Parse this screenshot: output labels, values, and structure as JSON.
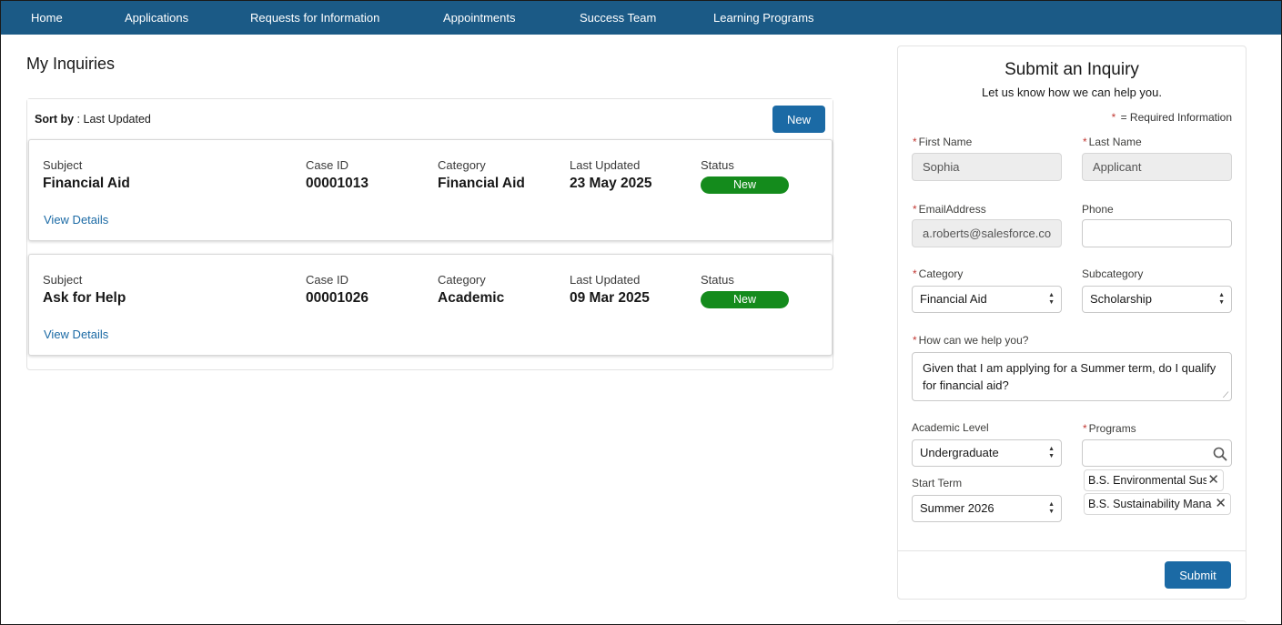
{
  "nav": {
    "items": [
      "Home",
      "Applications",
      "Requests for Information",
      "Appointments",
      "Success Team",
      "Learning Programs"
    ]
  },
  "inquiries": {
    "title": "My Inquiries",
    "sort_label": "Sort by",
    "sort_value": ": Last Updated",
    "new_button": "New",
    "columns": {
      "subject": "Subject",
      "case_id": "Case ID",
      "category": "Category",
      "last_updated": "Last Updated",
      "status": "Status"
    },
    "view_details": "View Details",
    "cases": [
      {
        "subject": "Financial Aid",
        "case_id": "00001013",
        "category": "Financial Aid",
        "last_updated": "23 May 2025",
        "status": "New"
      },
      {
        "subject": "Ask for Help",
        "case_id": "00001026",
        "category": "Academic",
        "last_updated": "09 Mar 2025",
        "status": "New"
      }
    ]
  },
  "form": {
    "title": "Submit an Inquiry",
    "subtitle": "Let us know how we can help you.",
    "required_marker": "*",
    "required_info": "= Required Information",
    "first_name_label": "First Name",
    "first_name_value": "Sophia",
    "last_name_label": "Last Name",
    "last_name_value": "Applicant",
    "email_label": "EmailAddress",
    "email_value": "a.roberts@salesforce.co",
    "phone_label": "Phone",
    "phone_value": "",
    "category_label": "Category",
    "category_value": "Financial Aid",
    "subcategory_label": "Subcategory",
    "subcategory_value": "Scholarship",
    "help_label": "How can we help you?",
    "help_value": "Given that I am applying for a Summer term, do I qualify for financial aid?",
    "academic_level_label": "Academic Level",
    "academic_level_value": "Undergraduate",
    "programs_label": "Programs",
    "programs_search_value": "",
    "start_term_label": "Start Term",
    "start_term_value": "Summer 2026",
    "selected_programs": [
      "B.S. Environmental Sus",
      "B.S. Sustainability Mana"
    ],
    "submit_button": "Submit"
  },
  "colors": {
    "nav_bg": "#1b5a86",
    "primary_button": "#1b6aa5",
    "status_new": "#148b1c",
    "required": "#c23934"
  }
}
